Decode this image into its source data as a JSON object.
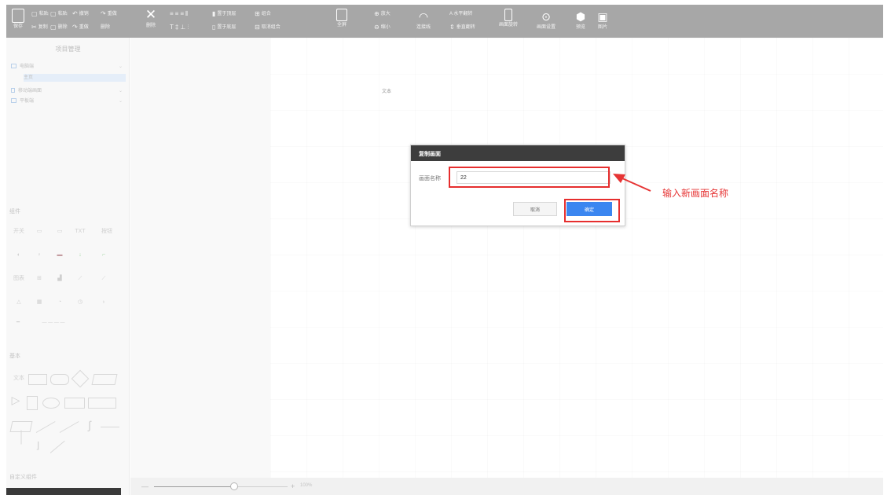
{
  "toolbar": {
    "cell1": "保存",
    "cell2a": "粘贴",
    "cell2b": "复制",
    "cell3a": "粘贴",
    "cell3b": "删除",
    "cell4a": "撤销",
    "cell4b": "重做",
    "cell5a": "重做",
    "cell5b": "删除",
    "cell6": "删除",
    "cell7": "置于顶层",
    "cell8": "置于底层",
    "cell9": "组合",
    "cell10": "取消组合",
    "cell11": "全屏",
    "cell12a": "放大",
    "cell12b": "缩小",
    "cell13": "连接线",
    "cell14a": "A 水平翻转",
    "cell14b": "垂直翻转",
    "cell15": "画面旋转",
    "cell16": "画面设置",
    "cell17": "预览",
    "cell18": "图片"
  },
  "left_panel": {
    "title": "项目管理",
    "tree": {
      "item1": "电脑端",
      "item2": "主页",
      "item3": "移动端画面",
      "item4": "平板端"
    },
    "components_label": "组件",
    "component_row_text": [
      "开关",
      "TXT",
      "按钮",
      "图表"
    ],
    "shapes_label": "基本",
    "shape_row_text": [
      "文本"
    ],
    "bottom_label": "自定义组件"
  },
  "canvas": {
    "text": "文本"
  },
  "statusbar": {
    "zoom_out": "—",
    "zoom_in": "+",
    "zoom_value": "100%",
    "zoom_level": 0.6
  },
  "dialog": {
    "title": "复制画面",
    "field_label": "画面名称",
    "field_value": "22",
    "cancel": "取消",
    "ok": "确定"
  },
  "annotation": {
    "text": "输入新画面名称",
    "color": "#e63434"
  }
}
